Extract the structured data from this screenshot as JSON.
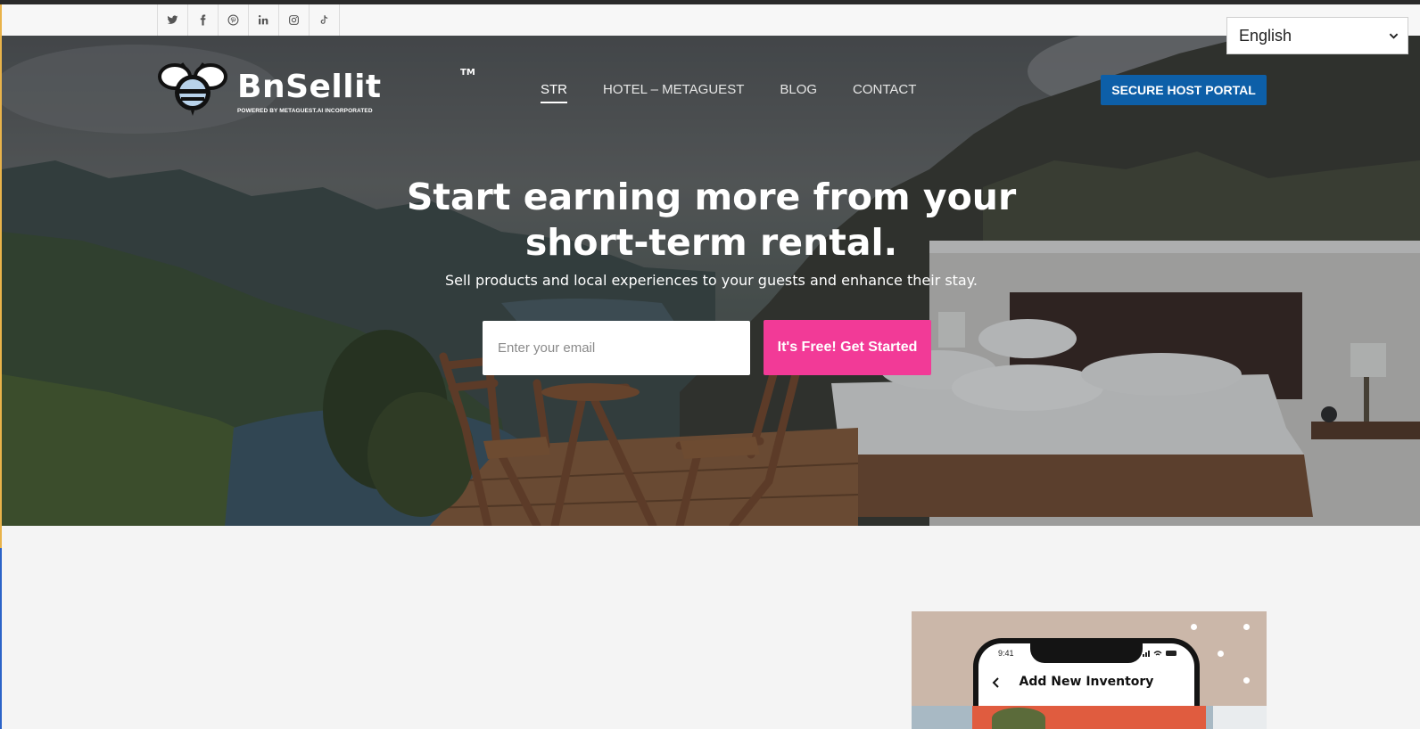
{
  "social": [
    {
      "name": "twitter-icon"
    },
    {
      "name": "facebook-icon"
    },
    {
      "name": "pinterest-icon"
    },
    {
      "name": "linkedin-icon"
    },
    {
      "name": "instagram-icon"
    },
    {
      "name": "tiktok-icon"
    }
  ],
  "language": {
    "selected": "English"
  },
  "logo": {
    "brand": "BnSellit",
    "tm": "TM",
    "tagline": "POWERED BY METAGUEST.AI INCORPORATED"
  },
  "nav": {
    "items": [
      "STR",
      "HOTEL – METAGUEST",
      "BLOG",
      "CONTACT"
    ],
    "active": "STR"
  },
  "portal_button": "SECURE HOST PORTAL",
  "hero": {
    "headline_line1": "Start earning more from your",
    "headline_line2": "short-term rental.",
    "subheadline": "Sell products and local experiences to your guests and enhance their stay.",
    "email_placeholder": "Enter your email",
    "cta": "It's Free! Get Started"
  },
  "app_preview": {
    "time": "9:41",
    "title": "Add New Inventory"
  },
  "colors": {
    "cta": "#f23a97",
    "portal": "#0d5fa8",
    "card_bg": "#cbb7a9"
  }
}
